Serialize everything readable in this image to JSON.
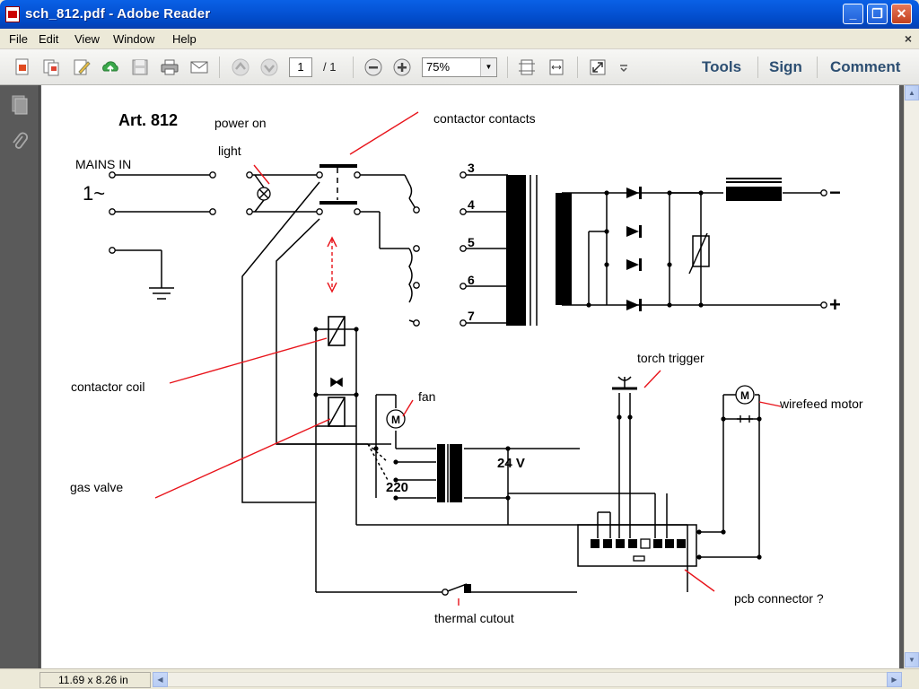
{
  "window": {
    "title": "sch_812.pdf - Adobe Reader"
  },
  "menu": {
    "items": [
      "File",
      "Edit",
      "View",
      "Window",
      "Help"
    ]
  },
  "toolbar": {
    "page_current": "1",
    "page_total": "/ 1",
    "zoom": "75%",
    "tools_label": "Tools",
    "sign_label": "Sign",
    "comment_label": "Comment"
  },
  "status": {
    "page_size": "11.69 x 8.26 in"
  },
  "schematic": {
    "title": "Art. 812",
    "labels": {
      "power_on": "power on",
      "light": "light",
      "contactor_contacts": "contactor contacts",
      "mains_in": "MAINS IN",
      "phase": "1~",
      "contactor_coil": "contactor coil",
      "fan": "fan",
      "gas_valve": "gas valve",
      "torch_trigger": "torch trigger",
      "wirefeed_motor": "wirefeed motor",
      "v220": "220",
      "v24": "24 V",
      "pcb_connector": "pcb connector ?",
      "thermal_cutout": "thermal cutout",
      "minus": "−",
      "plus": "+"
    },
    "taps": [
      "3",
      "4",
      "5",
      "6",
      "7"
    ]
  },
  "colors": {
    "accent_annotation": "#e8141b",
    "title_blue": "#0054e3",
    "right_links": "#2d4f72"
  }
}
